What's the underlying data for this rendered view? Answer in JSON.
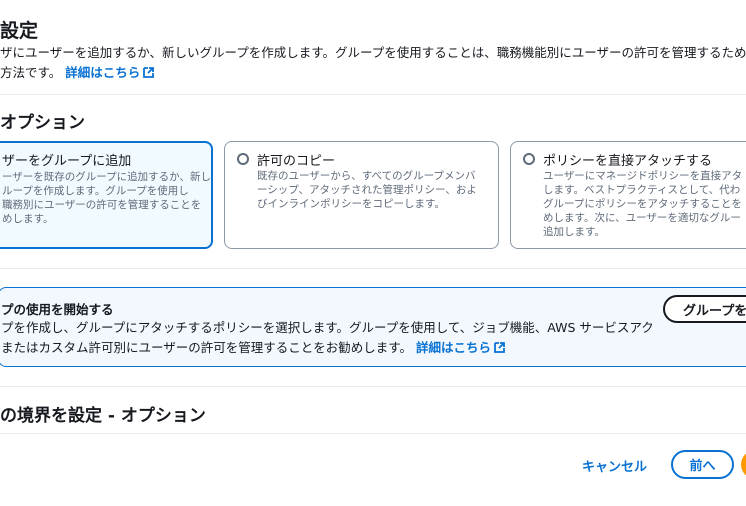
{
  "page": {
    "title": "設定",
    "description_line1": "ザにユーザーを追加するか、新しいグループを作成します。グループを使用することは、職務機能別にユーザーの許可を管理するための",
    "description_line2": "方法です。",
    "learn_more": "詳細はこちら"
  },
  "options": {
    "heading": "オプション",
    "cards": [
      {
        "title": "ザーをグループに追加",
        "selected": true,
        "desc": [
          "ーザーを既存のグループに追加するか、新し",
          "ループを作成します。グループを使用し",
          "職務別にユーザーの許可を管理することを",
          "めします。"
        ]
      },
      {
        "title": "許可のコピー",
        "selected": false,
        "desc": [
          "既存のユーザーから、すべてのグループメンバ",
          "ーシップ、アタッチされた管理ポリシー、およ",
          "びインラインポリシーをコピーします。"
        ]
      },
      {
        "title": "ポリシーを直接アタッチする",
        "selected": false,
        "desc": [
          "ユーザーにマネージドポリシーを直接アタ",
          "します。ベストプラクティスとして、代わ",
          "グループにポリシーをアタッチすることを",
          "めします。次に、ユーザーを適切なグルー",
          "追加します。"
        ]
      }
    ]
  },
  "info_box": {
    "title": "プの使用を開始する",
    "line1": "プを作成し、グループにアタッチするポリシーを選択します。グループを使用して、ジョブ機能、AWS サービスアク",
    "line2": "またはカスタム許可別にユーザーの許可を管理することをお勧めします。",
    "learn_more": "詳細はこちら",
    "button": "グループを"
  },
  "boundary": {
    "heading": "の境界を設定 - オプション"
  },
  "footer": {
    "cancel": "キャンセル",
    "previous": "前へ"
  },
  "colors": {
    "accent": "#0972d3",
    "primary": "#ff9900",
    "text": "#16191f",
    "muted": "#5f6b7a"
  }
}
